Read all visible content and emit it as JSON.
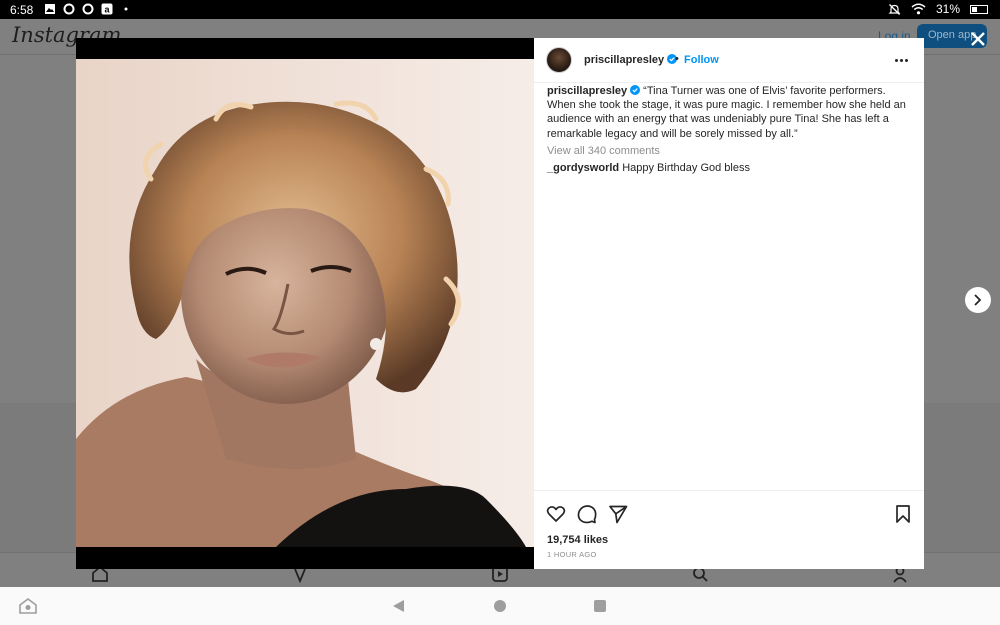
{
  "status_bar": {
    "time": "6:58",
    "battery": "31%",
    "battery_level": 0.31,
    "left_icons": [
      "image-icon",
      "circle-icon",
      "circle-icon",
      "amazon-icon",
      "dot-icon"
    ],
    "right_icons": [
      "mute-icon",
      "wifi-icon",
      "battery-icon"
    ]
  },
  "background": {
    "logo": "Instagram",
    "login": "Log in",
    "open_app": "Open app"
  },
  "post": {
    "username": "priscillapresley",
    "verified": true,
    "dot": "•",
    "follow": "Follow",
    "caption_user": "priscillapresley",
    "caption": "“Tina Turner was one of Elvis’ favorite performers. When she took the stage, it was pure magic. I remember how she held an audience with an energy that was undeniably pure Tina! She has left a remarkable legacy and will be sorely missed by all.”",
    "view_all": "View all 340 comments",
    "comments": [
      {
        "user": "_gordysworld",
        "text": "Happy Birthday God bless"
      }
    ],
    "likes": "19,754 likes",
    "time_ago": "1 HOUR AGO"
  },
  "colors": {
    "accent": "#0095f6",
    "text": "#262626",
    "muted": "#8e8e8e",
    "overlay": "#7f7f7f"
  }
}
